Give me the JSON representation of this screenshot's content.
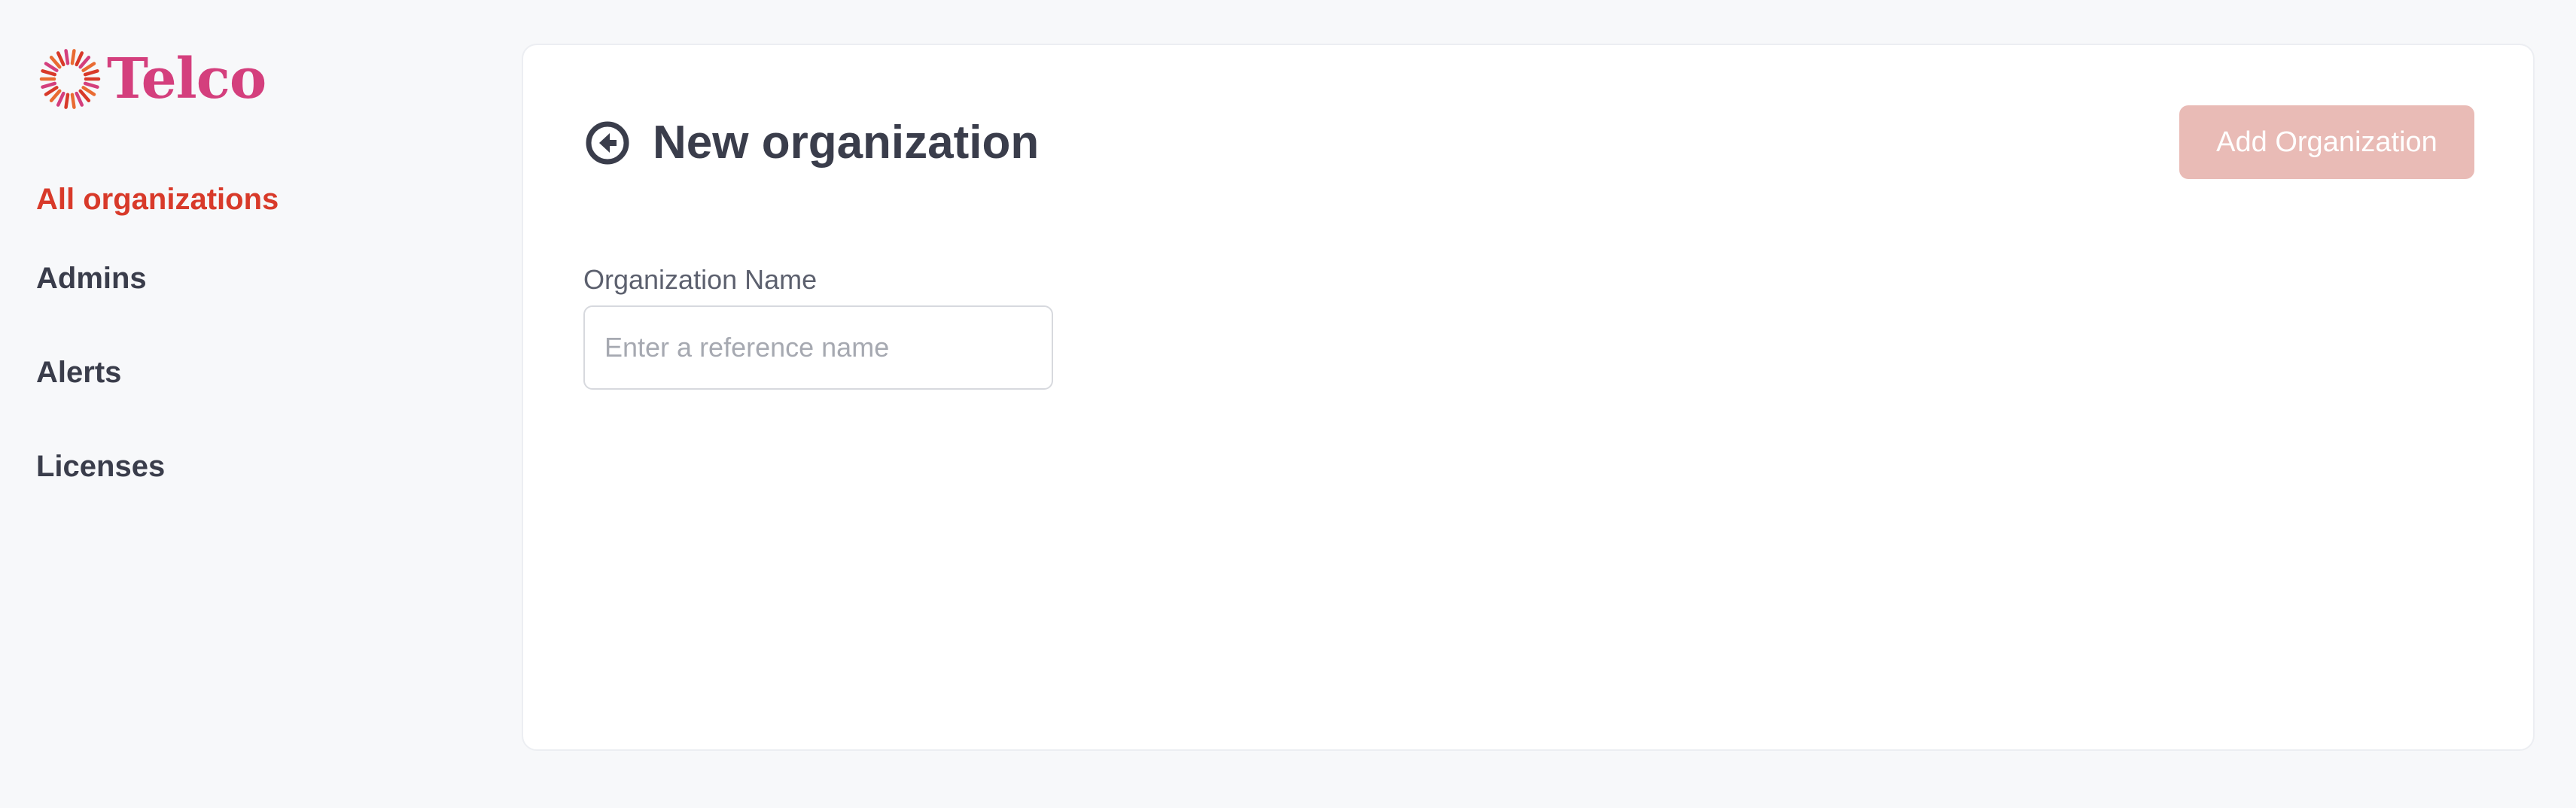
{
  "brand": {
    "name": "Telco",
    "color": "#d43f7d",
    "mark_colors": [
      "#d83a2a",
      "#d43f7d",
      "#e96b32"
    ]
  },
  "sidebar": {
    "items": [
      {
        "label": "All organizations",
        "active": true
      },
      {
        "label": "Admins",
        "active": false
      },
      {
        "label": "Alerts",
        "active": false
      },
      {
        "label": "Licenses",
        "active": false
      }
    ],
    "active_color": "#d83a2a"
  },
  "page": {
    "back_icon": "arrow-left-circle-icon",
    "title": "New organization",
    "add_button_label": "Add Organization",
    "add_button_color": "#e9bbb6"
  },
  "form": {
    "org_name_label": "Organization Name",
    "org_name_value": "",
    "org_name_placeholder": "Enter a reference name"
  }
}
